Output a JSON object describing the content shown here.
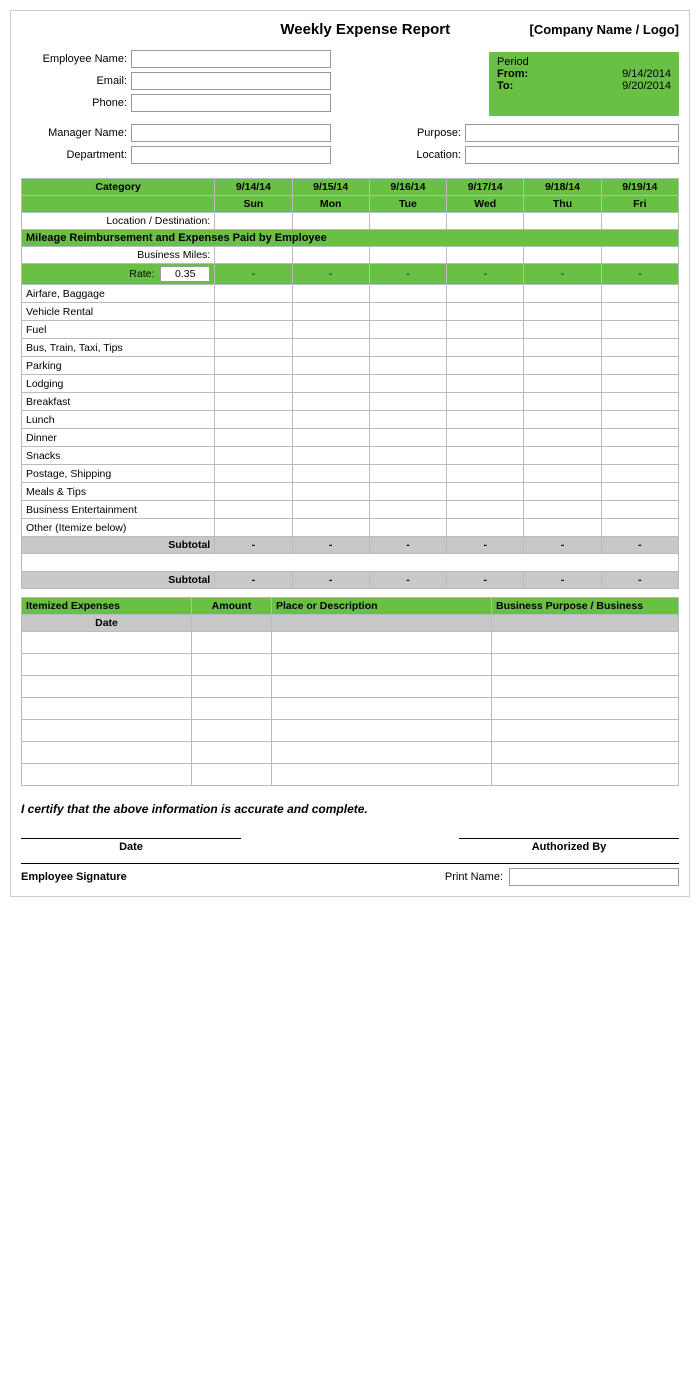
{
  "header": {
    "title": "Weekly Expense Report",
    "company": "[Company Name / Logo]"
  },
  "period": {
    "label": "Period",
    "from_label": "From:",
    "from_value": "9/14/2014",
    "to_label": "To:",
    "to_value": "9/20/2014"
  },
  "employee": {
    "name_label": "Employee Name:",
    "email_label": "Email:",
    "phone_label": "Phone:"
  },
  "manager": {
    "name_label": "Manager Name:",
    "dept_label": "Department:",
    "purpose_label": "Purpose:",
    "location_label": "Location:"
  },
  "table": {
    "category_label": "Category",
    "location_destination": "Location / Destination:",
    "dates": [
      "9/14/14",
      "9/15/14",
      "9/16/14",
      "9/17/14",
      "9/18/14",
      "9/19/14"
    ],
    "days": [
      "Sun",
      "Mon",
      "Tue",
      "Wed",
      "Thu",
      "Fri"
    ],
    "mileage_section": "Mileage Reimbursement and Expenses Paid by Employee",
    "business_miles_label": "Business Miles:",
    "rate_label": "Rate:",
    "rate_value": "0.35",
    "categories": [
      "Airfare, Baggage",
      "Vehicle Rental",
      "Fuel",
      "Bus, Train, Taxi, Tips",
      "Parking",
      "Lodging",
      "Breakfast",
      "Lunch",
      "Dinner",
      "Snacks",
      "Postage, Shipping",
      "Meals & Tips",
      "Business Entertainment",
      "Other (Itemize below)"
    ],
    "subtotal_label": "Subtotal",
    "dash": "-"
  },
  "itemized": {
    "header": "Itemized Expenses",
    "amount_label": "Amount",
    "place_label": "Place or Description",
    "purpose_label": "Business Purpose / Business",
    "date_label": "Date"
  },
  "certify_text": "I certify that the above information is accurate and complete.",
  "signature": {
    "date_label": "Date",
    "authorized_label": "Authorized By",
    "emp_sig_label": "Employee Signature",
    "print_name_label": "Print Name:"
  }
}
